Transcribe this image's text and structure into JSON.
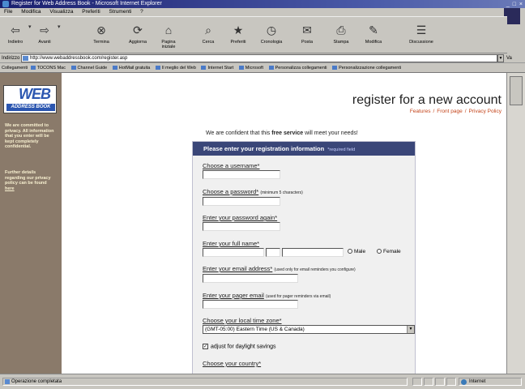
{
  "window": {
    "title": "Register for Web Address Book - Microsoft Internet Explorer",
    "controls": "_ □ ×"
  },
  "menu": [
    "File",
    "Modifica",
    "Visualizza",
    "Preferiti",
    "Strumenti",
    "?"
  ],
  "toolbar": [
    {
      "label": "Indietro",
      "icon": "back-arrow-icon"
    },
    {
      "label": "Avanti",
      "icon": "forward-arrow-icon"
    },
    {
      "label": "Termina",
      "icon": "stop-icon"
    },
    {
      "label": "Aggiorna",
      "icon": "refresh-icon"
    },
    {
      "label": "Pagina iniziale",
      "icon": "home-icon"
    },
    {
      "label": "Cerca",
      "icon": "search-icon"
    },
    {
      "label": "Preferiti",
      "icon": "favorites-icon"
    },
    {
      "label": "Cronologia",
      "icon": "history-icon"
    },
    {
      "label": "Posta",
      "icon": "mail-icon"
    },
    {
      "label": "Stampa",
      "icon": "print-icon"
    },
    {
      "label": "Modifica",
      "icon": "edit-icon"
    },
    {
      "label": "Discussione",
      "icon": "discuss-icon"
    }
  ],
  "address": {
    "label": "Indirizzo",
    "url": "http://www.webaddressbook.com/register.asp",
    "go_label": "Va"
  },
  "links": {
    "label": "Collegamenti",
    "items": [
      "TOCONS Mac",
      "Channel Guide",
      "HotMail gratuita",
      "Il meglio del Web",
      "Internet Start",
      "Microsoft",
      "Personalizza collegamenti",
      "Personalizzazione collegamenti"
    ]
  },
  "sidebar": {
    "logo_main": "WEB",
    "logo_sub": "ADDRESS BOOK",
    "text1": "We are committed to privacy. All information that you enter will be kept completely confidential.",
    "text2": "Further details regarding our privacy policy can be found",
    "text2_link": "here"
  },
  "header": {
    "title": "register for a new account",
    "links": [
      "Features",
      "Front page",
      "Privacy Policy"
    ]
  },
  "intro": {
    "before": "We are confident that this ",
    "bold": "free service",
    "after": " will meet your needs!"
  },
  "form": {
    "header": "Please enter your registration information",
    "required_note": "*required field",
    "username_label": "Choose a username*",
    "password_label": "Choose a password*",
    "password_note": "(minimum 5 characters)",
    "password_again_label": "Enter your password again*",
    "fullname_label": "Enter your full name*",
    "male_label": "Male",
    "female_label": "Female",
    "email_label": "Enter your email address*",
    "email_note": "(used only for email reminders you configure)",
    "pager_label": "Enter your pager email",
    "pager_note": "(used for pager reminders via email)",
    "timezone_label": "Choose your local time zone*",
    "timezone_value": "(GMT-05:00) Eastern Time (US & Canada)",
    "dst_label": "adjust for daylight savings",
    "dst_checked": true,
    "country_label": "Choose your country*"
  },
  "status": {
    "text": "Operazione completata",
    "zone": "Internet"
  }
}
